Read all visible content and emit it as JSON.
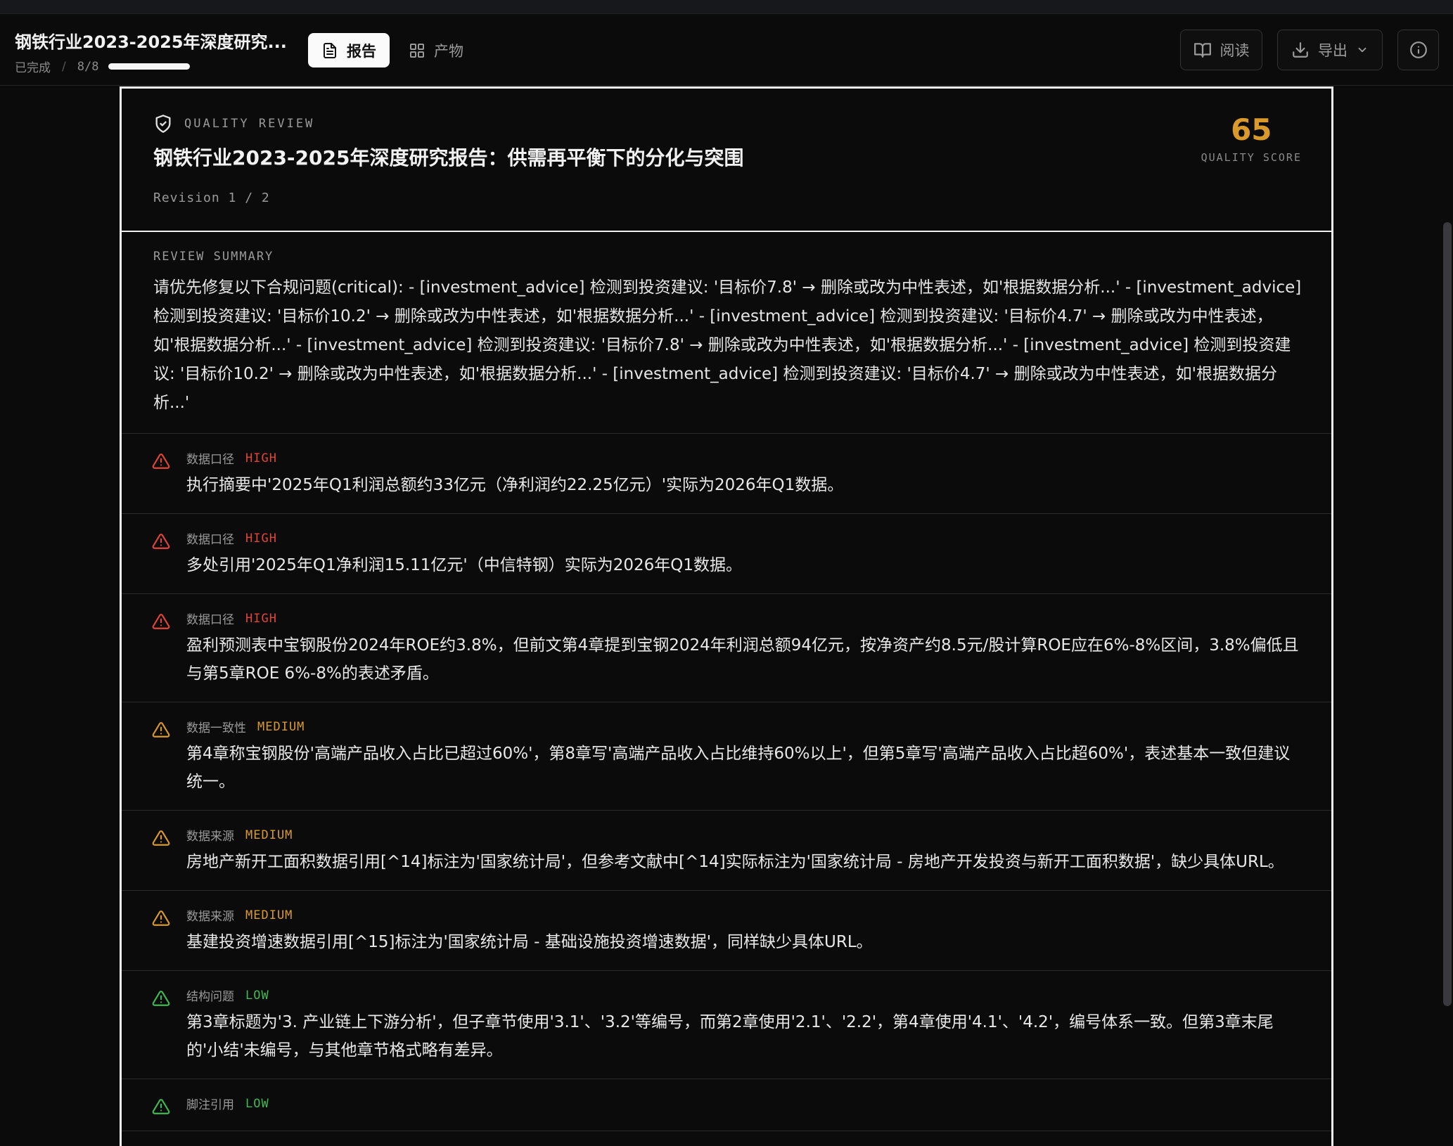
{
  "header": {
    "title": "钢铁行业2023-2025年深度研究...",
    "status": "已完成",
    "separator": "/",
    "steps": "8/8",
    "progress": 1.0,
    "tabs": [
      {
        "label": "报告",
        "icon": "document-icon",
        "active": true
      },
      {
        "label": "产物",
        "icon": "grid-icon",
        "active": false
      }
    ],
    "read_label": "阅读",
    "export_label": "导出"
  },
  "review": {
    "label": "QUALITY REVIEW",
    "title": "钢铁行业2023-2025年深度研究报告：供需再平衡下的分化与突围",
    "revision": "Revision 1 / 2",
    "score": "65",
    "score_label": "QUALITY SCORE",
    "score_color": "#d99a2b",
    "summary_label": "REVIEW SUMMARY",
    "summary_text": "请优先修复以下合规问题(critical): - [investment_advice] 检测到投资建议: '目标价7.8' → 删除或改为中性表述，如'根据数据分析...' - [investment_advice] 检测到投资建议: '目标价10.2' → 删除或改为中性表述，如'根据数据分析...' - [investment_advice] 检测到投资建议: '目标价4.7' → 删除或改为中性表述，如'根据数据分析...' - [investment_advice] 检测到投资建议: '目标价7.8' → 删除或改为中性表述，如'根据数据分析...' - [investment_advice] 检测到投资建议: '目标价10.2' → 删除或改为中性表述，如'根据数据分析...' - [investment_advice] 检测到投资建议: '目标价4.7' → 删除或改为中性表述，如'根据数据分析...'"
  },
  "issues": [
    {
      "category": "数据口径",
      "severity": "HIGH",
      "color": "#e0453a",
      "text": "执行摘要中'2025年Q1利润总额约33亿元（净利润约22.25亿元）'实际为2026年Q1数据。"
    },
    {
      "category": "数据口径",
      "severity": "HIGH",
      "color": "#e0453a",
      "text": "多处引用'2025年Q1净利润15.11亿元'（中信特钢）实际为2026年Q1数据。"
    },
    {
      "category": "数据口径",
      "severity": "HIGH",
      "color": "#e0453a",
      "text": "盈利预测表中宝钢股份2024年ROE约3.8%，但前文第4章提到宝钢2024年利润总额94亿元，按净资产约8.5元/股计算ROE应在6%-8%区间，3.8%偏低且与第5章ROE 6%-8%的表述矛盾。"
    },
    {
      "category": "数据一致性",
      "severity": "MEDIUM",
      "color": "#d99a2b",
      "text": "第4章称宝钢股份'高端产品收入占比已超过60%'，第8章写'高端产品收入占比维持60%以上'，但第5章写'高端产品收入占比超60%'，表述基本一致但建议统一。"
    },
    {
      "category": "数据来源",
      "severity": "MEDIUM",
      "color": "#d99a2b",
      "text": "房地产新开工面积数据引用[^14]标注为'国家统计局'，但参考文献中[^14]实际标注为'国家统计局 - 房地产开发投资与新开工面积数据'，缺少具体URL。"
    },
    {
      "category": "数据来源",
      "severity": "MEDIUM",
      "color": "#d99a2b",
      "text": "基建投资增速数据引用[^15]标注为'国家统计局 - 基础设施投资增速数据'，同样缺少具体URL。"
    },
    {
      "category": "结构问题",
      "severity": "LOW",
      "color": "#3fb950",
      "text": "第3章标题为'3. 产业链上下游分析'，但子章节使用'3.1'、'3.2'等编号，而第2章使用'2.1'、'2.2'，第4章使用'4.1'、'4.2'，编号体系一致。但第3章末尾的'小结'未编号，与其他章节格式略有差异。"
    },
    {
      "category": "脚注引用",
      "severity": "LOW",
      "color": "#3fb950",
      "text": ""
    }
  ]
}
